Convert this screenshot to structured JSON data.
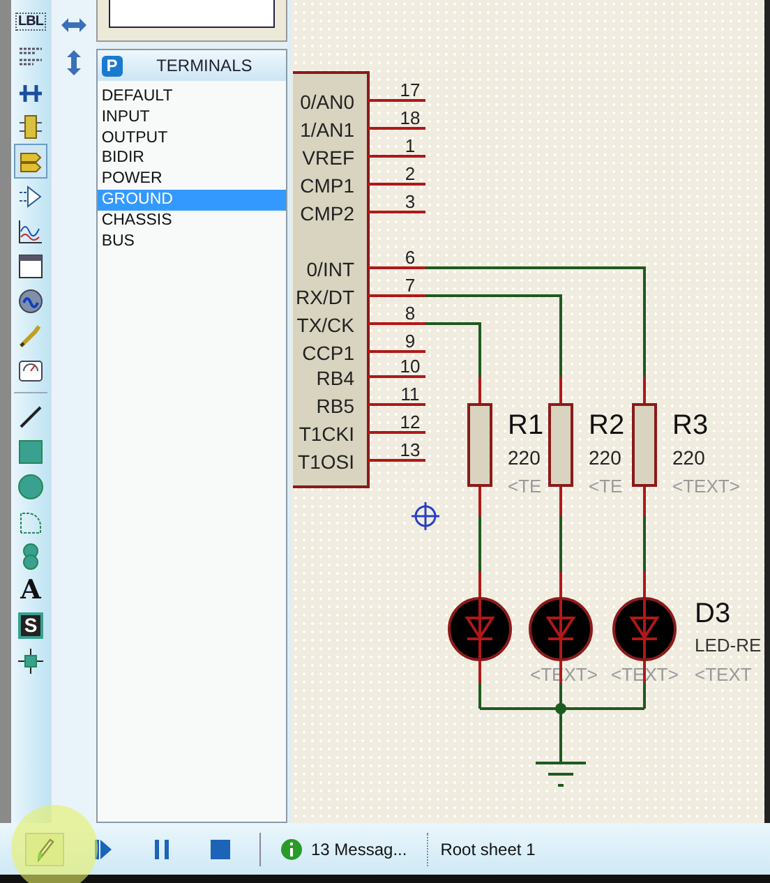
{
  "toolbar": [
    {
      "kind": "label",
      "glyph": "LBL",
      "selected": false
    },
    {
      "kind": "script",
      "selected": false
    },
    {
      "kind": "bus",
      "selected": false
    },
    {
      "kind": "subcircuit",
      "selected": false
    },
    {
      "kind": "terminal",
      "selected": true
    },
    {
      "kind": "port",
      "selected": false
    },
    {
      "kind": "graph",
      "selected": false
    },
    {
      "kind": "tape",
      "selected": false
    },
    {
      "kind": "generator",
      "selected": false
    },
    {
      "kind": "probe",
      "selected": false
    },
    {
      "kind": "instrument",
      "selected": false
    },
    {
      "kind": "separator"
    },
    {
      "kind": "line",
      "selected": false
    },
    {
      "kind": "box",
      "selected": false
    },
    {
      "kind": "circle",
      "selected": false
    },
    {
      "kind": "arc",
      "selected": false
    },
    {
      "kind": "path",
      "selected": false
    },
    {
      "kind": "text",
      "glyph": "A",
      "selected": false
    },
    {
      "kind": "symbol",
      "glyph": "S",
      "selected": false
    },
    {
      "kind": "marker",
      "selected": false
    }
  ],
  "rotate_tools": [
    {
      "kind": "horizontal"
    },
    {
      "kind": "vertical"
    }
  ],
  "terminals_panel": {
    "badge": "P",
    "title": "TERMINALS",
    "items": [
      {
        "label": "DEFAULT",
        "selected": false
      },
      {
        "label": "INPUT",
        "selected": false
      },
      {
        "label": "OUTPUT",
        "selected": false
      },
      {
        "label": "BIDIR",
        "selected": false
      },
      {
        "label": "POWER",
        "selected": false
      },
      {
        "label": "GROUND",
        "selected": true
      },
      {
        "label": "CHASSIS",
        "selected": false
      },
      {
        "label": "BUS",
        "selected": false
      }
    ]
  },
  "schematic": {
    "pins": [
      {
        "label": "0/AN0",
        "number": "17"
      },
      {
        "label": "1/AN1",
        "number": "18"
      },
      {
        "label": "VREF",
        "number": "1"
      },
      {
        "label": "CMP1",
        "number": "2"
      },
      {
        "label": "CMP2",
        "number": "3"
      },
      {
        "label": "0/INT",
        "number": "6"
      },
      {
        "label": "RX/DT",
        "number": "7"
      },
      {
        "label": "TX/CK",
        "number": "8"
      },
      {
        "label": "CCP1",
        "number": "9"
      },
      {
        "label": "RB4",
        "number": "10"
      },
      {
        "label": "RB5",
        "number": "11"
      },
      {
        "label": "T1CKI",
        "number": "12"
      },
      {
        "label": "T1OSI",
        "number": "13"
      }
    ],
    "resistors": [
      {
        "name": "R1",
        "value": "220",
        "text": "<TE"
      },
      {
        "name": "R2",
        "value": "220",
        "text": "<TE"
      },
      {
        "name": "R3",
        "value": "220",
        "text": "<TEXT>"
      }
    ],
    "leds": [
      {
        "text": "<TEXT>"
      },
      {
        "text": "<TEXT>"
      },
      {
        "name": "D3",
        "value": "LED-RE",
        "text": "<TEXT"
      }
    ]
  },
  "status_bar": {
    "tools": [
      {
        "kind": "edit",
        "selected": true
      },
      {
        "kind": "play",
        "selected": false
      },
      {
        "kind": "pause",
        "selected": false
      },
      {
        "kind": "stop",
        "selected": false
      }
    ],
    "messages": "13 Messag...",
    "sheet": "Root sheet 1"
  }
}
